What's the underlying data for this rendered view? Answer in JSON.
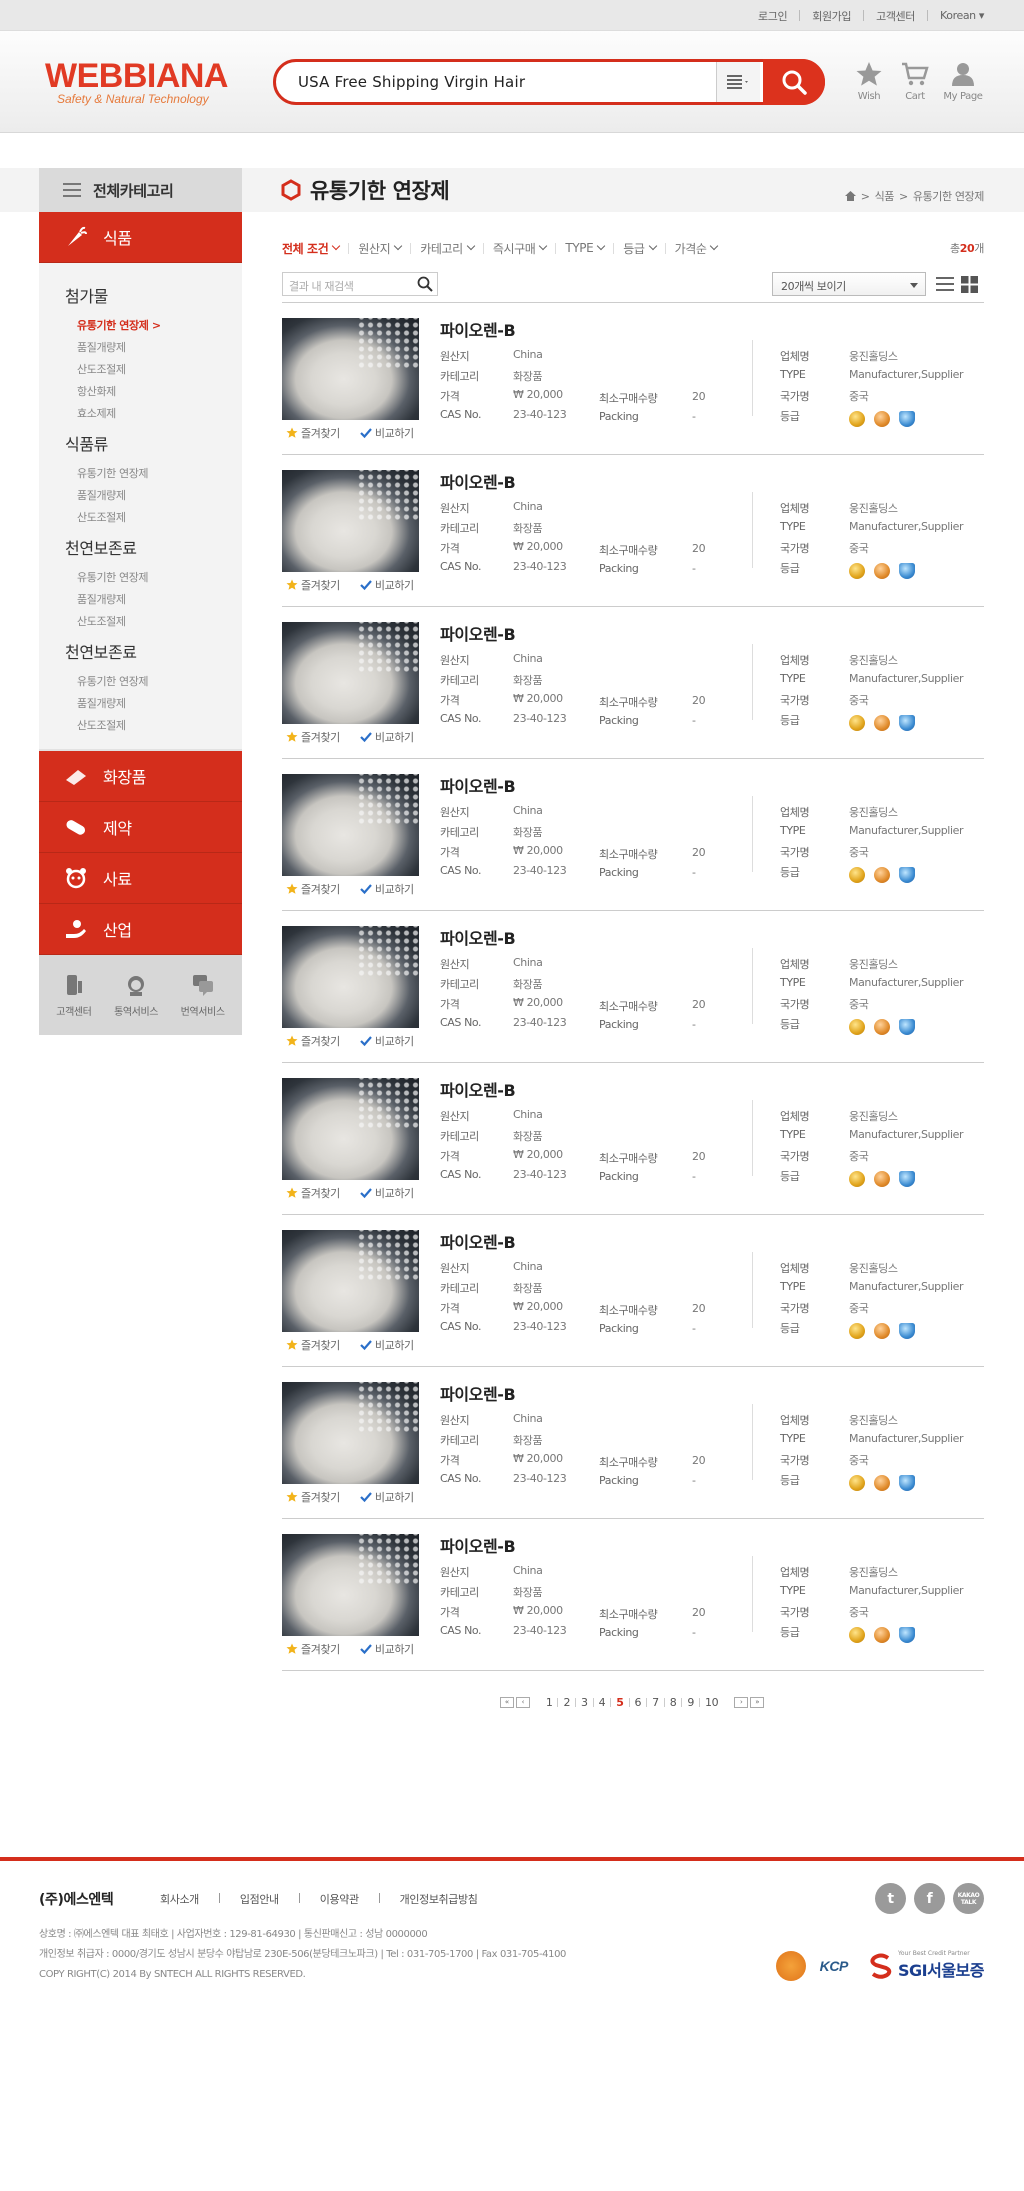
{
  "top_links": [
    "로그인",
    "회원가입",
    "고객센터",
    "Korean"
  ],
  "header": {
    "logo_main": "WEBBIANA",
    "logo_sub": "Safety & Natural Technology",
    "search_value": "USA Free Shipping Virgin Hair",
    "icons": [
      {
        "label": "Wish",
        "icon": "star-icon"
      },
      {
        "label": "Cart",
        "icon": "cart-icon"
      },
      {
        "label": "My Page",
        "icon": "user-icon"
      }
    ]
  },
  "sidebar": {
    "all_category": "전체카테고리",
    "active_cat": "식품",
    "groups": [
      {
        "title": "첨가물",
        "items": [
          "유통기한 연장제",
          "품질개량제",
          "산도조절제",
          "항산화제",
          "효소제제"
        ]
      },
      {
        "title": "식품류",
        "items": [
          "유통기한 연장제",
          "품질개량제",
          "산도조절제"
        ]
      },
      {
        "title": "천연보존료",
        "items": [
          "유통기한 연장제",
          "품질개량제",
          "산도조절제"
        ]
      },
      {
        "title": "천연보존료",
        "items": [
          "유통기한 연장제",
          "품질개량제",
          "산도조절제"
        ]
      }
    ],
    "active_sub": "유통기한 연장제",
    "other_cats": [
      "화장품",
      "제약",
      "사료",
      "산업"
    ],
    "services": [
      "고객센터",
      "통역서비스",
      "번역서비스"
    ]
  },
  "main": {
    "title": "유통기한 연장제",
    "breadcrumb": [
      "식품",
      "유통기한 연장제"
    ],
    "filters": [
      "전체 조건",
      "원산지",
      "카테고리",
      "즉시구매",
      "TYPE",
      "등급",
      "가격순"
    ],
    "total_prefix": "총",
    "total_count": "20",
    "total_suffix": "개",
    "inner_search_placeholder": "결과 내 재검색",
    "per_page": "20개씩 보이기",
    "labels": {
      "origin": "원산지",
      "category": "카테고리",
      "price": "가격",
      "cas": "CAS No.",
      "min_order": "최소구매수량",
      "packing": "Packing",
      "company": "업체명",
      "type": "TYPE",
      "country": "국가명",
      "grade": "등급",
      "wish": "즐겨찾기",
      "compare": "비교하기"
    },
    "products": [
      {
        "name": "파이오렌-B",
        "origin": "China",
        "category": "화장품",
        "price": "₩ 20,000",
        "cas": "23-40-123",
        "min_order": "20",
        "packing": "-",
        "company": "웅진홀딩스",
        "type": "Manufacturer,Supplier",
        "country": "중국"
      },
      {
        "name": "파이오렌-B",
        "origin": "China",
        "category": "화장품",
        "price": "₩ 20,000",
        "cas": "23-40-123",
        "min_order": "20",
        "packing": "-",
        "company": "웅진홀딩스",
        "type": "Manufacturer,Supplier",
        "country": "중국"
      },
      {
        "name": "파이오렌-B",
        "origin": "China",
        "category": "화장품",
        "price": "₩ 20,000",
        "cas": "23-40-123",
        "min_order": "20",
        "packing": "-",
        "company": "웅진홀딩스",
        "type": "Manufacturer,Supplier",
        "country": "중국"
      },
      {
        "name": "파이오렌-B",
        "origin": "China",
        "category": "화장품",
        "price": "₩ 20,000",
        "cas": "23-40-123",
        "min_order": "20",
        "packing": "-",
        "company": "웅진홀딩스",
        "type": "Manufacturer,Supplier",
        "country": "중국"
      },
      {
        "name": "파이오렌-B",
        "origin": "China",
        "category": "화장품",
        "price": "₩ 20,000",
        "cas": "23-40-123",
        "min_order": "20",
        "packing": "-",
        "company": "웅진홀딩스",
        "type": "Manufacturer,Supplier",
        "country": "중국"
      },
      {
        "name": "파이오렌-B",
        "origin": "China",
        "category": "화장품",
        "price": "₩ 20,000",
        "cas": "23-40-123",
        "min_order": "20",
        "packing": "-",
        "company": "웅진홀딩스",
        "type": "Manufacturer,Supplier",
        "country": "중국"
      },
      {
        "name": "파이오렌-B",
        "origin": "China",
        "category": "화장품",
        "price": "₩ 20,000",
        "cas": "23-40-123",
        "min_order": "20",
        "packing": "-",
        "company": "웅진홀딩스",
        "type": "Manufacturer,Supplier",
        "country": "중국"
      },
      {
        "name": "파이오렌-B",
        "origin": "China",
        "category": "화장품",
        "price": "₩ 20,000",
        "cas": "23-40-123",
        "min_order": "20",
        "packing": "-",
        "company": "웅진홀딩스",
        "type": "Manufacturer,Supplier",
        "country": "중국"
      },
      {
        "name": "파이오렌-B",
        "origin": "China",
        "category": "화장품",
        "price": "₩ 20,000",
        "cas": "23-40-123",
        "min_order": "20",
        "packing": "-",
        "company": "웅진홀딩스",
        "type": "Manufacturer,Supplier",
        "country": "중국"
      }
    ]
  },
  "pagination": {
    "pages": [
      "1",
      "2",
      "3",
      "4",
      "5",
      "6",
      "7",
      "8",
      "9",
      "10"
    ],
    "current": "5"
  },
  "footer": {
    "company": "(주)에스엔텍",
    "links": [
      "회사소개",
      "입점안내",
      "이용약관",
      "개인정보취급방침"
    ],
    "info": [
      "상호명 : ㈜에스엔텍  대표 최태호  |  사업자번호 : 129-81-64930  |  통신판매신고 : 성남 0000000",
      "개인정보 취급자 : 0000/경기도 성남시 분당수 야탑남로 230E-506(분당테크노파크)  | Tel : 031-705-1700  | Fax 031-705-4100",
      "COPY RIGHT(C) 2014 By SNTECH ALL RIGHTS RESERVED."
    ],
    "social": [
      "twitter-icon",
      "facebook-icon",
      "kakaotalk-icon"
    ],
    "social_text": {
      "kakao": "KAKAO TALK"
    },
    "logos": {
      "kcp": "KCP",
      "sgi": "SGI서울보증",
      "sgi_tag": "Your Best Credit Partner"
    }
  },
  "colors": {
    "brand_red": "#d42e1c",
    "logo_red": "#e13a24"
  }
}
